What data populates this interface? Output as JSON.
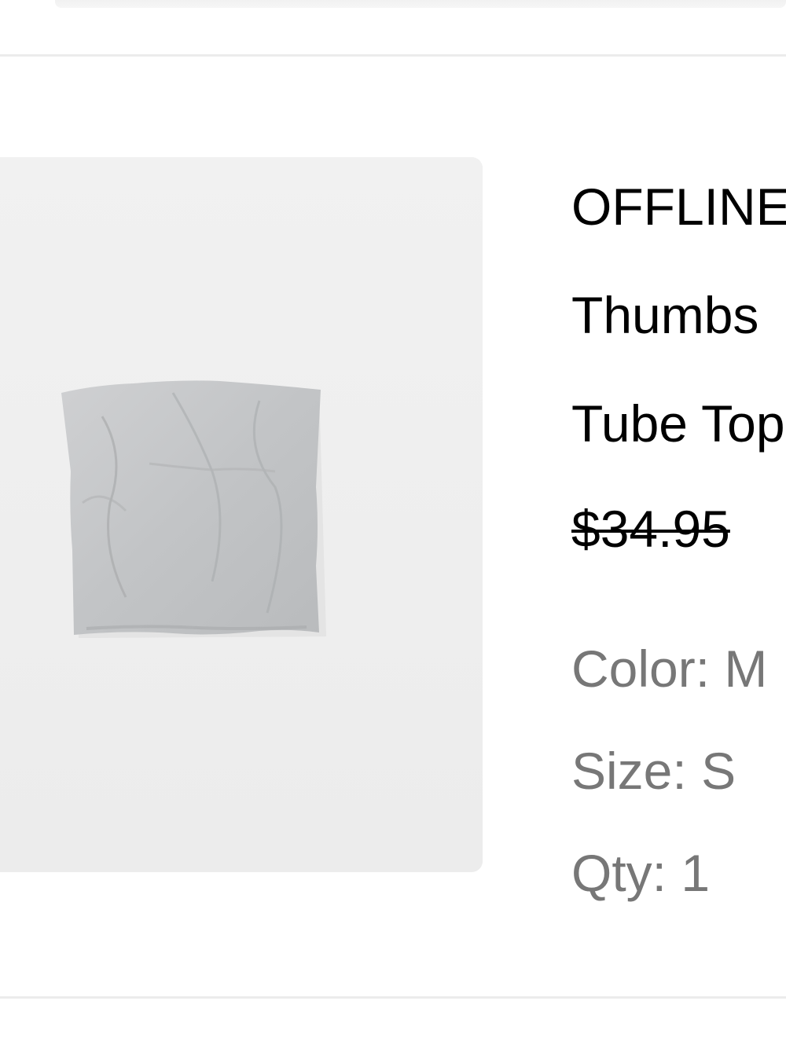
{
  "product": {
    "image_alt": "Gray strapless tube top",
    "title_line1": "OFFLINE",
    "title_line2": "Thumbs",
    "title_line3": "Tube Top",
    "price": "$34.95",
    "color_label": "Color: M",
    "size_label": "Size: S",
    "qty_label": "Qty: 1"
  },
  "colors": {
    "image_bg": "#efefef",
    "garment": "#c6c8ca",
    "title": "#000000",
    "meta": "#777777",
    "divider": "#ececec"
  }
}
